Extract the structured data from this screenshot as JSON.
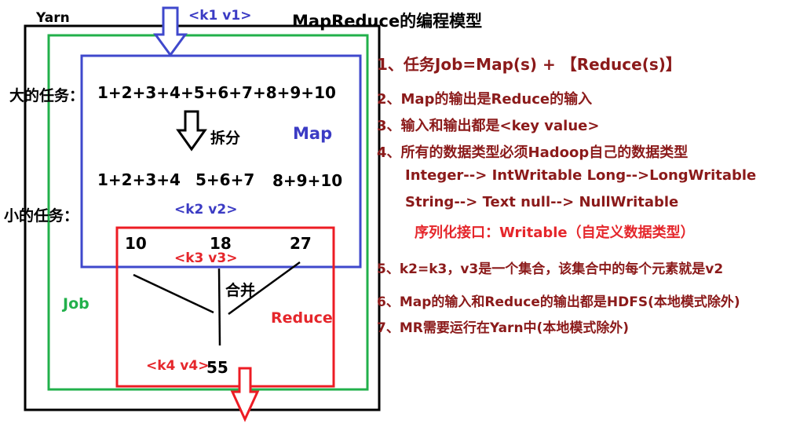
{
  "title": "MapReduce的编程模型",
  "labels": {
    "yarn": "Yarn",
    "job": "Job",
    "map": "Map",
    "reduce": "Reduce",
    "big_task": "大的任务：",
    "small_task": "小的任务：",
    "split": "拆分",
    "merge": "合并"
  },
  "expressions": {
    "full": "1+2+3+4+5+6+7+8+9+10",
    "part1": "1+2+3+4",
    "part2": "5+6+7",
    "part3": "8+9+10"
  },
  "values": {
    "v1": "10",
    "v2": "18",
    "v3": "27",
    "result": "55"
  },
  "kv": {
    "k1v1": "<k1  v1>",
    "k2v2": "<k2  v2>",
    "k3v3": "<k3   v3>",
    "k4v4": "<k4  v4>"
  },
  "notes": [
    "1、任务Job=Map(s) + 【Reduce(s)】",
    "2、Map的输出是Reduce的输入",
    "3、输入和输出都是<key value>",
    "4、所有的数据类型必须Hadoop自己的数据类型",
    "Integer--> IntWritable  Long-->LongWritable",
    "String--> Text      null--> NullWritable",
    "序列化接口：Writable（自定义数据类型）",
    "5、k2=k3，v3是一个集合，该集合中的每个元素就是v2",
    "6、Map的输入和Reduce的输出都是HDFS(本地模式除外)",
    "7、MR需要运行在Yarn中(本地模式除外)"
  ],
  "colors": {
    "yarn_border": "#000000",
    "job_border": "#22b04b",
    "map_border": "#3f48cc",
    "reduce_border": "#ed1c24",
    "note_text": "#8b1a1a"
  }
}
